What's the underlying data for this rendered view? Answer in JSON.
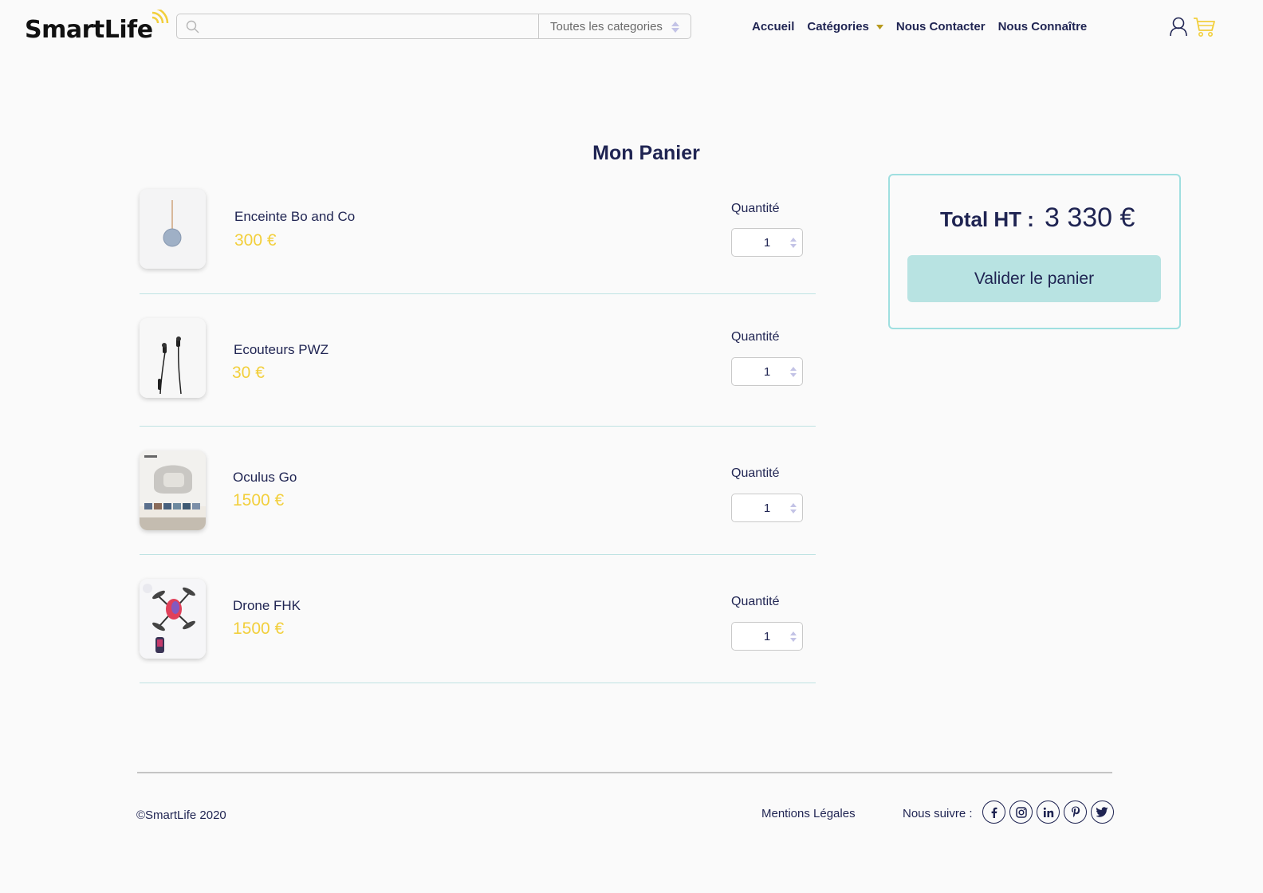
{
  "header": {
    "logo_text": "SmartLife",
    "search": {
      "placeholder": "",
      "category": "Toutes les categories"
    },
    "nav": [
      "Accueil",
      "Catégories",
      "Nous Contacter",
      "Nous Connaître"
    ]
  },
  "page": {
    "title": "Mon Panier"
  },
  "cart": {
    "qty_label": "Quantité",
    "items": [
      {
        "name": "Enceinte Bo and Co",
        "price": "300 €",
        "quantity": "1"
      },
      {
        "name": "Ecouteurs PWZ",
        "price": "30 €",
        "quantity": "1"
      },
      {
        "name": "Oculus Go",
        "price": "1500 €",
        "quantity": "1"
      },
      {
        "name": "Drone FHK",
        "price": "1500 €",
        "quantity": "1"
      }
    ]
  },
  "summary": {
    "label": "Total HT :",
    "value": "3 330 €",
    "button": "Valider le panier"
  },
  "footer": {
    "copyright": "©SmartLife 2020",
    "legal": "Mentions Légales",
    "follow": "Nous suivre :",
    "socials": [
      "facebook-icon",
      "instagram-icon",
      "linkedin-icon",
      "pinterest-icon",
      "twitter-icon"
    ]
  },
  "colors": {
    "navy": "#1f2452",
    "accent_yellow": "#f2cf3c",
    "teal": "#b8e3e2",
    "teal_border": "#9fdfe0"
  }
}
